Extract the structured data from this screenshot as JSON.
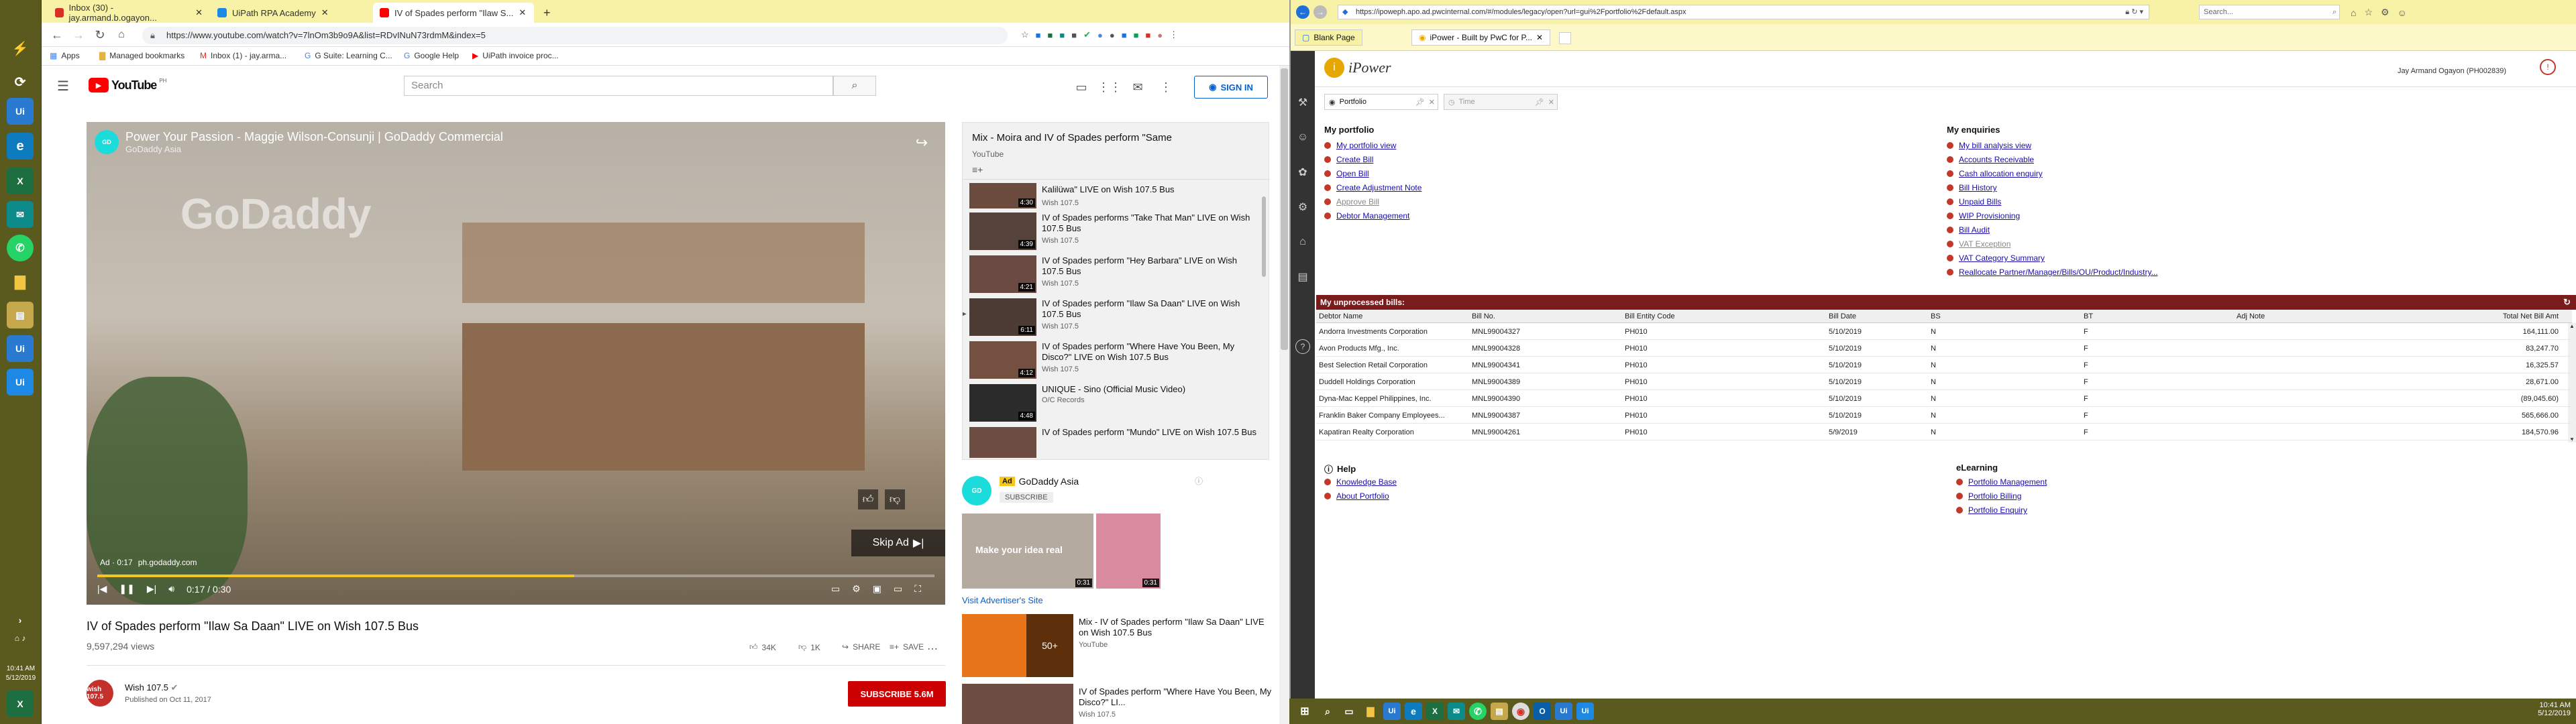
{
  "sidebar": {
    "clock_time": "10:41 AM",
    "clock_date": "5/12/2019"
  },
  "browser": {
    "tabs": [
      {
        "label": "Inbox (30) - jay.armand.b.ogayon..."
      },
      {
        "label": "UiPath RPA Academy"
      },
      {
        "label": "IV of Spades perform \"Ilaw S..."
      }
    ],
    "url": "https://www.youtube.com/watch?v=7lnOm3b9o9A&list=RDvINuN73rdmM&index=5",
    "bookmarks": [
      "Apps",
      "Managed bookmarks",
      "Inbox (1) - jay.arma...",
      "G Suite: Learning C...",
      "Google Help",
      "UiPath invoice proc..."
    ]
  },
  "youtube": {
    "logo": "YouTube",
    "logo_sup": "PH",
    "search_placeholder": "Search",
    "signin": "SIGN IN",
    "ad": {
      "title": "Power Your Passion - Maggie Wilson-Consunji | GoDaddy Commercial",
      "channel": "GoDaddy Asia",
      "watermark": "GoDaddy",
      "ad_timer": "Ad · 0:17",
      "ad_url": "ph.godaddy.com",
      "skip": "Skip Ad",
      "time": "0:17 / 0:30"
    },
    "video": {
      "title": "IV of Spades perform \"Ilaw Sa Daan\" LIVE on Wish 107.5 Bus",
      "views": "9,597,294 views",
      "likes": "34K",
      "dislikes": "1K",
      "share": "SHARE",
      "save": "SAVE",
      "channel": "Wish 107.5",
      "published": "Published on Oct 11, 2017",
      "subscribe": "SUBSCRIBE  5.6M",
      "channel_logo": "wish 107.5"
    },
    "mix": {
      "title": "Mix - Moira and IV of Spades perform \"Same",
      "source": "YouTube",
      "items": [
        {
          "title": "Kalilüwa\" LIVE on Wish 107.5 Bus",
          "channel": "Wish 107.5",
          "duration": "4:30"
        },
        {
          "title": "IV of Spades performs \"Take That Man\" LIVE on Wish 107.5 Bus",
          "channel": "Wish 107.5",
          "duration": "4:39"
        },
        {
          "title": "IV of Spades perform \"Hey Barbara\" LIVE on Wish 107.5 Bus",
          "channel": "Wish 107.5",
          "duration": "4:21"
        },
        {
          "title": "IV of Spades perform \"Ilaw Sa Daan\" LIVE on Wish 107.5 Bus",
          "channel": "Wish 107.5",
          "duration": "6:11"
        },
        {
          "title": "IV of Spades perform \"Where Have You Been, My Disco?\" LIVE on Wish 107.5 Bus",
          "channel": "Wish 107.5",
          "duration": "4:12"
        },
        {
          "title": "UNIQUE - Sino (Official Music Video)",
          "channel": "O/C Records",
          "duration": "4:48"
        },
        {
          "title": "IV of Spades perform \"Mundo\" LIVE on Wish 107.5 Bus",
          "channel": "",
          "duration": ""
        }
      ]
    },
    "companion": {
      "ad_badge": "Ad",
      "advertiser": "GoDaddy Asia",
      "subscribe": "SUBSCRIBE",
      "thumb_text": "Make your idea real",
      "thumb_dur_1": "0:31",
      "thumb_dur_2": "0:31",
      "visit": "Visit Advertiser's Site"
    },
    "recs": [
      {
        "title": "Mix - IV of Spades perform \"Ilaw Sa Daan\" LIVE on Wish 107.5 Bus",
        "channel": "YouTube",
        "badge": "50+"
      },
      {
        "title": "IV of Spades perform \"Where Have You Been, My Disco?\" LI...",
        "channel": "Wish 107.5",
        "badge": ""
      }
    ]
  },
  "ipower": {
    "url": "https://ipoweph.apo.ad.pwcinternal.com/#/modules/legacy/open?url=gui%2Fportfolio%2Fdefault.aspx",
    "search": "Search...",
    "tabs": [
      "Blank Page",
      "iPower - Built by PwC for P..."
    ],
    "logo": "iPower",
    "user": "Jay Armand Ogayon (PH002839)",
    "module_tabs": [
      "Portfolio",
      "Time"
    ],
    "portfolio": {
      "heading": "My portfolio",
      "links": [
        {
          "label": "My portfolio view",
          "disabled": false
        },
        {
          "label": "Create Bill",
          "disabled": false
        },
        {
          "label": "Open Bill",
          "disabled": false
        },
        {
          "label": "Create Adjustment Note",
          "disabled": false
        },
        {
          "label": "Approve Bill",
          "disabled": true
        },
        {
          "label": "Debtor Management",
          "disabled": false
        }
      ]
    },
    "enquiries": {
      "heading": "My enquiries",
      "links": [
        {
          "label": "My bill analysis view",
          "disabled": false
        },
        {
          "label": "Accounts Receivable",
          "disabled": false
        },
        {
          "label": "Cash allocation enquiry",
          "disabled": false
        },
        {
          "label": "Bill History",
          "disabled": false
        },
        {
          "label": "Unpaid Bills",
          "disabled": false
        },
        {
          "label": "WIP Provisioning",
          "disabled": false
        },
        {
          "label": "Bill Audit",
          "disabled": false
        },
        {
          "label": "VAT Exception",
          "disabled": true
        },
        {
          "label": "VAT Category Summary",
          "disabled": false
        },
        {
          "label": "Reallocate Partner/Manager/Bills/OU/Product/Industry...",
          "disabled": false
        }
      ]
    },
    "unprocessed": {
      "heading": "My unprocessed bills:",
      "columns": [
        "Debtor Name",
        "Bill No.",
        "Bill Entity Code",
        "Bill Date",
        "BS",
        "BT",
        "Adj Note",
        "Total Net Bill Amt"
      ],
      "rows": [
        [
          "Andorra Investments Corporation",
          "MNL99004327",
          "PH010",
          "5/10/2019",
          "N",
          "F",
          "",
          "164,111.00"
        ],
        [
          "Avon Products Mfg., Inc.",
          "MNL99004328",
          "PH010",
          "5/10/2019",
          "N",
          "F",
          "",
          "83,247.70"
        ],
        [
          "Best Selection Retail Corporation",
          "MNL99004341",
          "PH010",
          "5/10/2019",
          "N",
          "F",
          "",
          "16,325.57"
        ],
        [
          "Duddell Holdings Corporation",
          "MNL99004389",
          "PH010",
          "5/10/2019",
          "N",
          "F",
          "",
          "28,671.00"
        ],
        [
          "Dyna-Mac Keppel Philippines, Inc.",
          "MNL99004390",
          "PH010",
          "5/10/2019",
          "N",
          "F",
          "",
          "(89,045.60)"
        ],
        [
          "Franklin Baker Company Employees...",
          "MNL99004387",
          "PH010",
          "5/10/2019",
          "N",
          "F",
          "",
          "565,666.00"
        ],
        [
          "Kapatiran Realty Corporation",
          "MNL99004261",
          "PH010",
          "5/9/2019",
          "N",
          "F",
          "",
          "184,570.96"
        ]
      ]
    },
    "help": {
      "heading": "Help",
      "links": [
        "Knowledge Base",
        "About Portfolio"
      ]
    },
    "elearning": {
      "heading": "eLearning",
      "links": [
        "Portfolio Management",
        "Portfolio Billing",
        "Portfolio Enquiry"
      ]
    }
  },
  "taskbar": {
    "time": "10:41 AM",
    "date": "5/12/2019"
  }
}
